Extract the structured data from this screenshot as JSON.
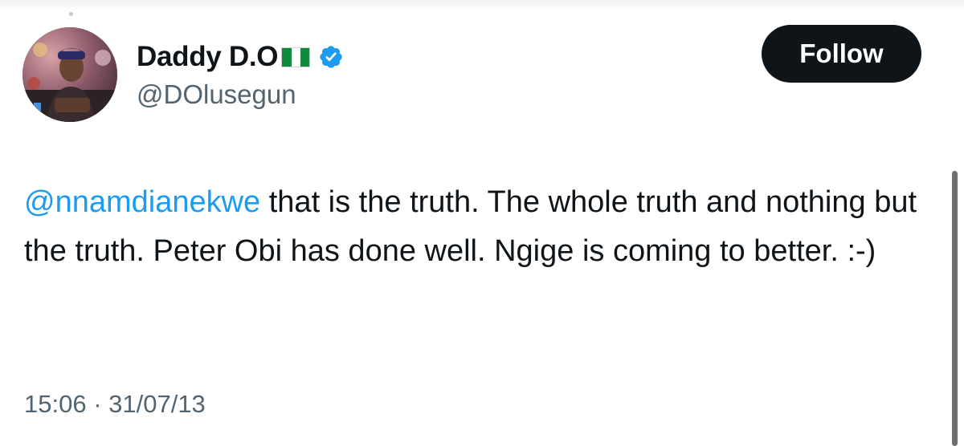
{
  "tweet": {
    "author": {
      "display_name": "Daddy D.O",
      "flag": "nigeria-flag",
      "verified": true,
      "handle": "@DOlusegun"
    },
    "follow_label": "Follow",
    "mention": "@nnamdianekwe",
    "text_after_mention": " that is the truth. The whole truth and nothing but the truth. Peter Obi has done well. Ngige is coming to better. :-)",
    "timestamp": "15:06 · 31/07/13"
  },
  "colors": {
    "mention": "#1d9bf0",
    "verified_badge": "#1d9bf0",
    "follow_button_bg": "#0f1419",
    "secondary_text": "#536471"
  },
  "icons": {
    "verified": "verified-badge-icon",
    "flag": "nigeria-flag-icon"
  }
}
